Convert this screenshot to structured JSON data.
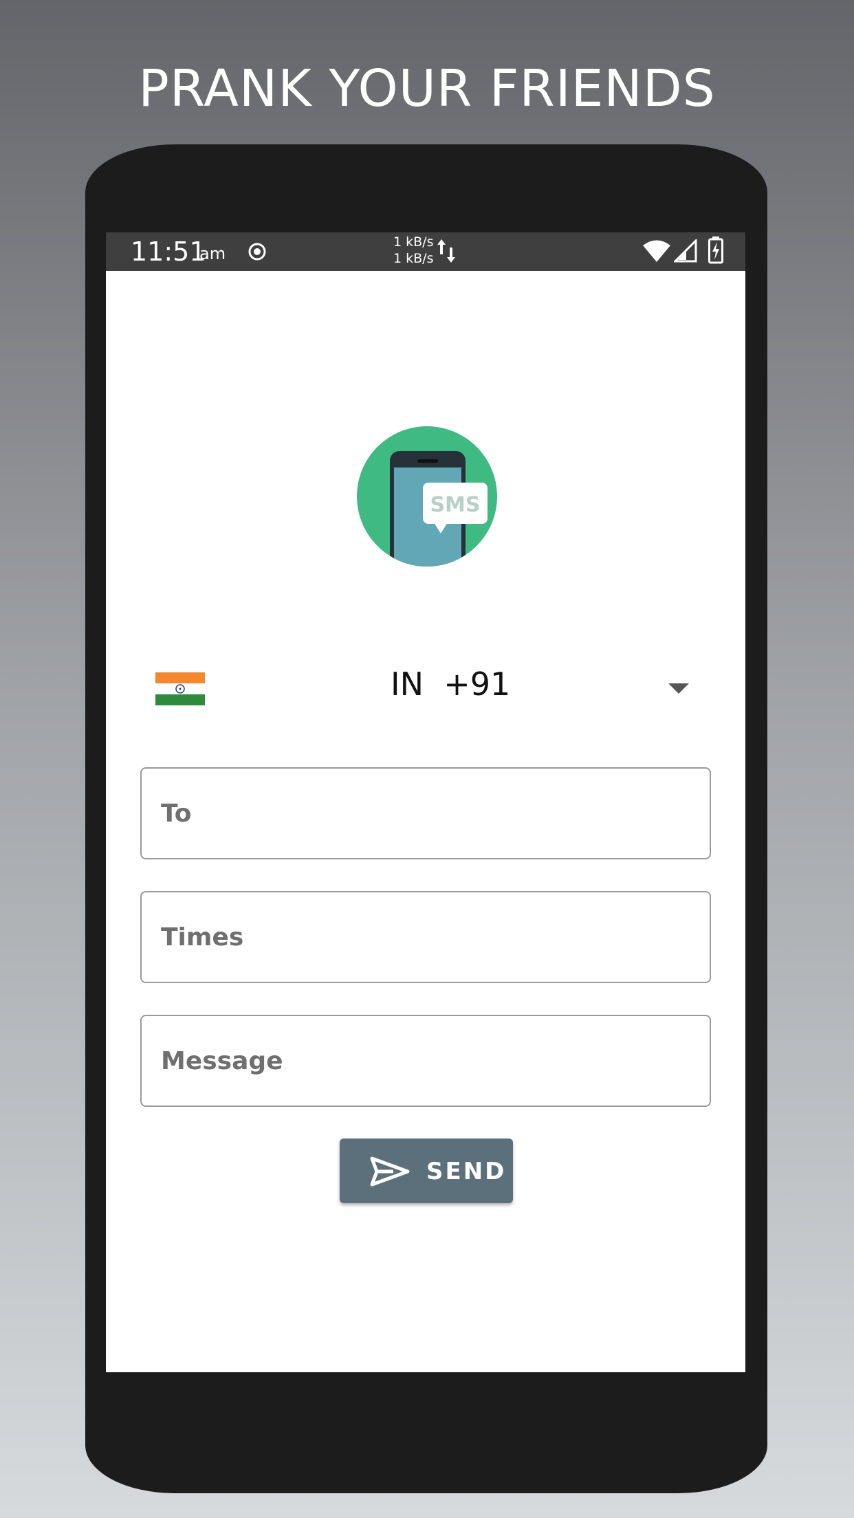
{
  "headline": "PRANK YOUR FRIENDS",
  "status_bar": {
    "time": "11:51",
    "ampm": "am",
    "upload_speed": "1 kB/s",
    "download_speed": "1 kB/s",
    "icons": [
      "record-icon",
      "data-transfer-icon",
      "wifi-icon",
      "cell-signal-icon",
      "battery-charging-icon"
    ]
  },
  "logo": {
    "badge_text": "SMS",
    "icon": "sms-phone-logo-icon",
    "colors": {
      "circle": "#3fba82",
      "screen": "#62a7b5",
      "bubble_text": "#b8cfc8"
    }
  },
  "country_picker": {
    "flag": "india-flag-icon",
    "display": "IN  +91"
  },
  "form": {
    "to_placeholder": "To",
    "times_placeholder": "Times",
    "message_placeholder": "Message",
    "send_label": "SEND"
  },
  "colors": {
    "button": "#5c707c",
    "status_bar": "#3f3f3f",
    "phone_body": "#1c1c1c"
  }
}
